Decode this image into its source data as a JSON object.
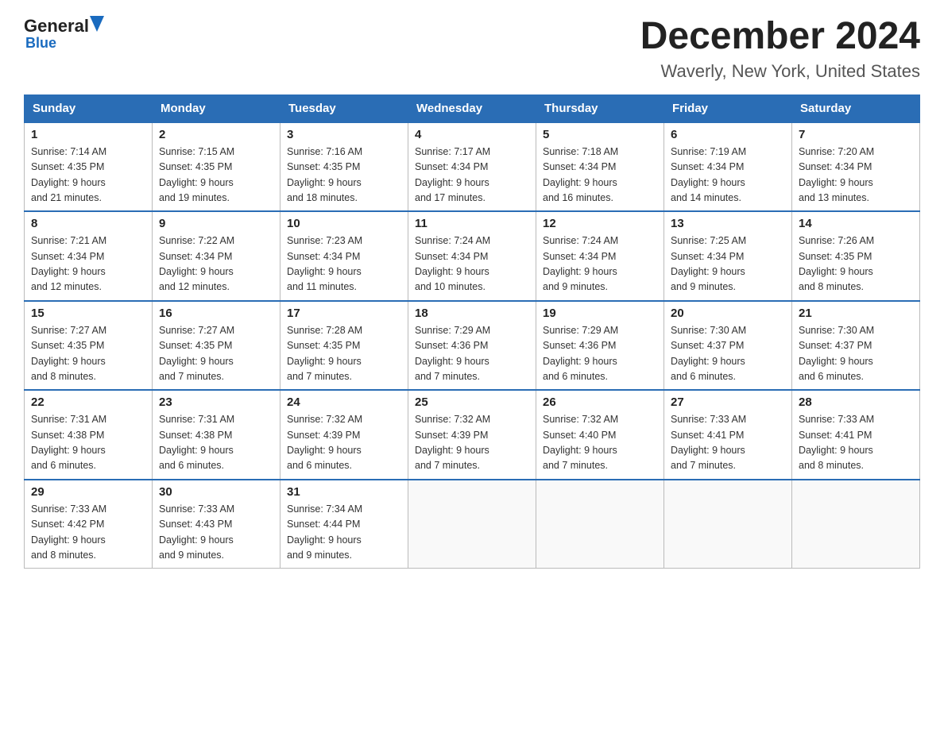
{
  "header": {
    "logo_general": "General",
    "logo_blue": "Blue",
    "month_title": "December 2024",
    "location": "Waverly, New York, United States"
  },
  "days_of_week": [
    "Sunday",
    "Monday",
    "Tuesday",
    "Wednesday",
    "Thursday",
    "Friday",
    "Saturday"
  ],
  "weeks": [
    [
      {
        "day": "1",
        "sunrise": "7:14 AM",
        "sunset": "4:35 PM",
        "daylight": "9 hours and 21 minutes."
      },
      {
        "day": "2",
        "sunrise": "7:15 AM",
        "sunset": "4:35 PM",
        "daylight": "9 hours and 19 minutes."
      },
      {
        "day": "3",
        "sunrise": "7:16 AM",
        "sunset": "4:35 PM",
        "daylight": "9 hours and 18 minutes."
      },
      {
        "day": "4",
        "sunrise": "7:17 AM",
        "sunset": "4:34 PM",
        "daylight": "9 hours and 17 minutes."
      },
      {
        "day": "5",
        "sunrise": "7:18 AM",
        "sunset": "4:34 PM",
        "daylight": "9 hours and 16 minutes."
      },
      {
        "day": "6",
        "sunrise": "7:19 AM",
        "sunset": "4:34 PM",
        "daylight": "9 hours and 14 minutes."
      },
      {
        "day": "7",
        "sunrise": "7:20 AM",
        "sunset": "4:34 PM",
        "daylight": "9 hours and 13 minutes."
      }
    ],
    [
      {
        "day": "8",
        "sunrise": "7:21 AM",
        "sunset": "4:34 PM",
        "daylight": "9 hours and 12 minutes."
      },
      {
        "day": "9",
        "sunrise": "7:22 AM",
        "sunset": "4:34 PM",
        "daylight": "9 hours and 12 minutes."
      },
      {
        "day": "10",
        "sunrise": "7:23 AM",
        "sunset": "4:34 PM",
        "daylight": "9 hours and 11 minutes."
      },
      {
        "day": "11",
        "sunrise": "7:24 AM",
        "sunset": "4:34 PM",
        "daylight": "9 hours and 10 minutes."
      },
      {
        "day": "12",
        "sunrise": "7:24 AM",
        "sunset": "4:34 PM",
        "daylight": "9 hours and 9 minutes."
      },
      {
        "day": "13",
        "sunrise": "7:25 AM",
        "sunset": "4:34 PM",
        "daylight": "9 hours and 9 minutes."
      },
      {
        "day": "14",
        "sunrise": "7:26 AM",
        "sunset": "4:35 PM",
        "daylight": "9 hours and 8 minutes."
      }
    ],
    [
      {
        "day": "15",
        "sunrise": "7:27 AM",
        "sunset": "4:35 PM",
        "daylight": "9 hours and 8 minutes."
      },
      {
        "day": "16",
        "sunrise": "7:27 AM",
        "sunset": "4:35 PM",
        "daylight": "9 hours and 7 minutes."
      },
      {
        "day": "17",
        "sunrise": "7:28 AM",
        "sunset": "4:35 PM",
        "daylight": "9 hours and 7 minutes."
      },
      {
        "day": "18",
        "sunrise": "7:29 AM",
        "sunset": "4:36 PM",
        "daylight": "9 hours and 7 minutes."
      },
      {
        "day": "19",
        "sunrise": "7:29 AM",
        "sunset": "4:36 PM",
        "daylight": "9 hours and 6 minutes."
      },
      {
        "day": "20",
        "sunrise": "7:30 AM",
        "sunset": "4:37 PM",
        "daylight": "9 hours and 6 minutes."
      },
      {
        "day": "21",
        "sunrise": "7:30 AM",
        "sunset": "4:37 PM",
        "daylight": "9 hours and 6 minutes."
      }
    ],
    [
      {
        "day": "22",
        "sunrise": "7:31 AM",
        "sunset": "4:38 PM",
        "daylight": "9 hours and 6 minutes."
      },
      {
        "day": "23",
        "sunrise": "7:31 AM",
        "sunset": "4:38 PM",
        "daylight": "9 hours and 6 minutes."
      },
      {
        "day": "24",
        "sunrise": "7:32 AM",
        "sunset": "4:39 PM",
        "daylight": "9 hours and 6 minutes."
      },
      {
        "day": "25",
        "sunrise": "7:32 AM",
        "sunset": "4:39 PM",
        "daylight": "9 hours and 7 minutes."
      },
      {
        "day": "26",
        "sunrise": "7:32 AM",
        "sunset": "4:40 PM",
        "daylight": "9 hours and 7 minutes."
      },
      {
        "day": "27",
        "sunrise": "7:33 AM",
        "sunset": "4:41 PM",
        "daylight": "9 hours and 7 minutes."
      },
      {
        "day": "28",
        "sunrise": "7:33 AM",
        "sunset": "4:41 PM",
        "daylight": "9 hours and 8 minutes."
      }
    ],
    [
      {
        "day": "29",
        "sunrise": "7:33 AM",
        "sunset": "4:42 PM",
        "daylight": "9 hours and 8 minutes."
      },
      {
        "day": "30",
        "sunrise": "7:33 AM",
        "sunset": "4:43 PM",
        "daylight": "9 hours and 9 minutes."
      },
      {
        "day": "31",
        "sunrise": "7:34 AM",
        "sunset": "4:44 PM",
        "daylight": "9 hours and 9 minutes."
      },
      null,
      null,
      null,
      null
    ]
  ]
}
